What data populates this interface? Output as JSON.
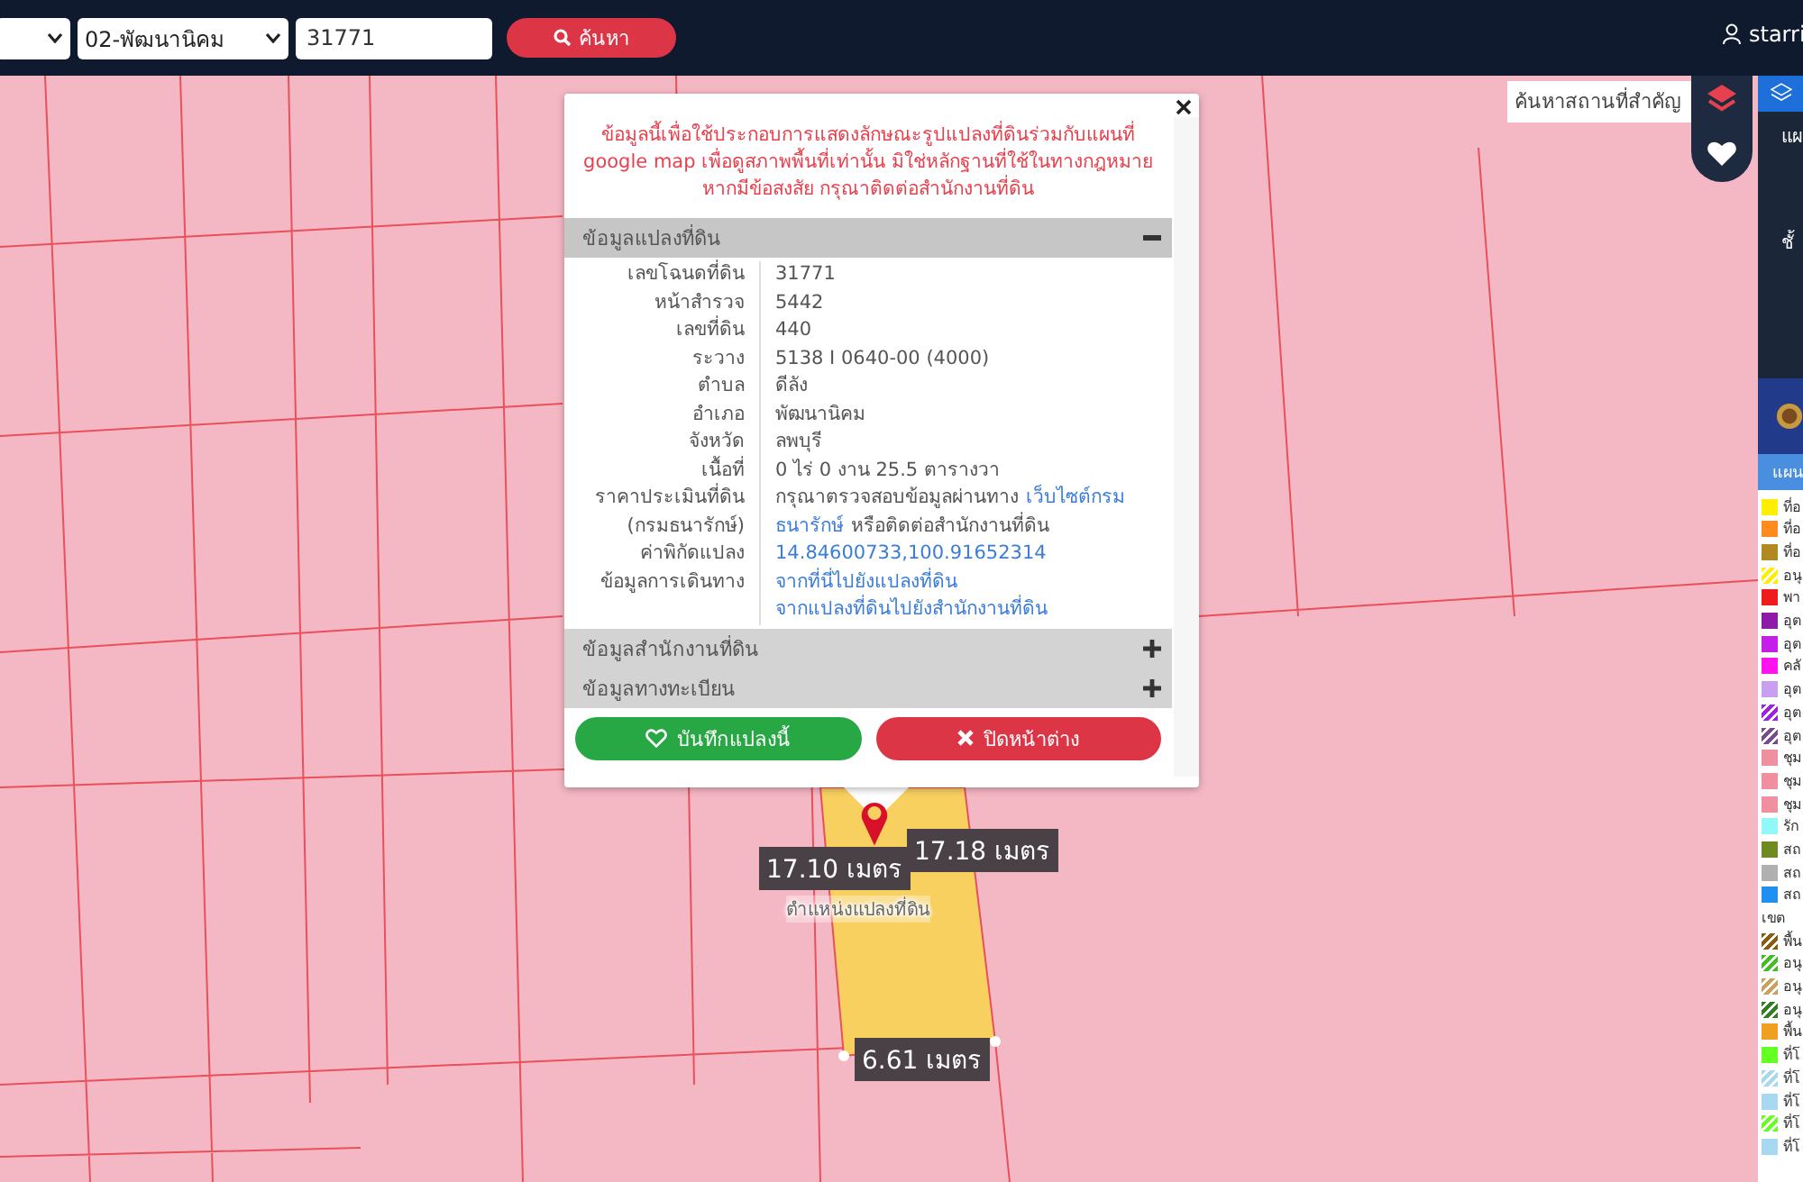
{
  "top_bar": {
    "district_select": {
      "value": "02-พัฒนานิคม"
    },
    "deed_field": {
      "value": "31771"
    },
    "search_button": {
      "label": "ค้นหา"
    },
    "user": {
      "name": "starri"
    }
  },
  "map": {
    "search_field": {
      "placeholder": "ค้นหาสถานที่สำคัญ"
    },
    "measurements": [
      {
        "label": "17.10 เมตร",
        "kind": "left"
      },
      {
        "label": "17.18 เมตร",
        "kind": "right"
      },
      {
        "label": "6.61 เมตร",
        "kind": "bottom"
      }
    ],
    "marker_label": "ตำแหน่งแปลงที่ดิน"
  },
  "popup": {
    "notice": "ข้อมูลนี้เพื่อใช้ประกอบการแสดงลักษณะรูปแปลงที่ดินร่วมกับแผนที่ google map เพื่อดูสภาพพื้นที่เท่านั้น มิใช่หลักฐานที่ใช้ในทางกฎหมาย หากมีข้อสงสัย กรุณาติดต่อสำนักงานที่ดิน",
    "sections": [
      {
        "title": "ข้อมูลแปลงที่ดิน",
        "expanded": true,
        "rows": [
          {
            "label": "เลขโฉนดที่ดิน",
            "value": [
              {
                "text": "31771",
                "link": false
              }
            ]
          },
          {
            "label": "หน้าสำรวจ",
            "value": [
              {
                "text": "5442",
                "link": false
              }
            ]
          },
          {
            "label": "เลขที่ดิน",
            "value": [
              {
                "text": "440",
                "link": false
              }
            ]
          },
          {
            "label": "ระวาง",
            "value": [
              {
                "text": "5138 I 0640-00 (4000)",
                "link": false
              }
            ]
          },
          {
            "label": "ตำบล",
            "value": [
              {
                "text": "ดีลัง",
                "link": false
              }
            ]
          },
          {
            "label": "อำเภอ",
            "value": [
              {
                "text": "พัฒนานิคม",
                "link": false
              }
            ]
          },
          {
            "label": "จังหวัด",
            "value": [
              {
                "text": "ลพบุรี",
                "link": false
              }
            ]
          },
          {
            "label": "เนื้อที่",
            "value": [
              {
                "text": "0 ไร่ 0 งาน 25.5 ตารางวา",
                "link": false
              }
            ]
          },
          {
            "label": "ราคาประเมินที่ดิน",
            "value": [
              {
                "text": "กรุณาตรวจสอบข้อมูลผ่านทาง",
                "link": false
              },
              {
                "text": "เว็บไซต์กรม",
                "link": true
              }
            ]
          },
          {
            "label": "(กรมธนารักษ์)",
            "value": [
              {
                "text": "ธนารักษ์",
                "link": true
              },
              {
                "text": "หรือติดต่อสำนักงานที่ดิน",
                "link": false
              }
            ]
          },
          {
            "label": "ค่าพิกัดแปลง",
            "value": [
              {
                "text": "14.84600733,100.91652314",
                "link": true
              }
            ]
          },
          {
            "label": "ข้อมูลการเดินทาง",
            "value": [
              {
                "text": "จากที่นี่ไปยังแปลงที่ดิน",
                "link": true
              }
            ]
          },
          {
            "value": [
              {
                "text": "จากแปลงที่ดินไปยังสำนักงานที่ดิน",
                "link": true
              }
            ]
          }
        ]
      },
      {
        "title": "ข้อมูลสำนักงานที่ดิน",
        "expanded": false
      },
      {
        "title": "ข้อมูลทางทะเบียน",
        "expanded": false
      }
    ],
    "buttons": [
      {
        "label": "บันทึกแปลงนี้",
        "kind": "save"
      },
      {
        "label": "ปิดหน้าต่าง",
        "kind": "close"
      }
    ]
  },
  "side_panel": {
    "title": "แผ",
    "layer_label": "ชั้",
    "band_label": "แผน",
    "legend": [
      {
        "label": "ที่อ",
        "color": "#ffee00",
        "kind": "solid"
      },
      {
        "label": "ที่อ",
        "color": "#ff8a1e",
        "kind": "solid"
      },
      {
        "label": "ที่อ",
        "color": "#b08a20",
        "kind": "solid"
      },
      {
        "label": "อนุ",
        "color": "#ffee00",
        "kind": "hatched"
      },
      {
        "label": "พา",
        "color": "#ee1c1c",
        "kind": "solid"
      },
      {
        "label": "อุต",
        "color": "#8e1aa8",
        "kind": "solid"
      },
      {
        "label": "อุต",
        "color": "#c41ee8",
        "kind": "solid"
      },
      {
        "label": "คลั",
        "color": "#ff14f0",
        "kind": "solid"
      },
      {
        "label": "อุต",
        "color": "#c8a0f0",
        "kind": "solid"
      },
      {
        "label": "อุต",
        "color": "#a020e0",
        "kind": "hatched"
      },
      {
        "label": "อุต",
        "color": "#7a4a90",
        "kind": "hatched"
      },
      {
        "label": "ชุม",
        "color": "#f08fa0",
        "kind": "solid"
      },
      {
        "label": "ชุม",
        "color": "#f08fa0",
        "kind": "solid"
      },
      {
        "label": "ชุม",
        "color": "#f08fa0",
        "kind": "solid"
      },
      {
        "label": "รัก",
        "color": "#90f8f8",
        "kind": "solid"
      },
      {
        "label": "สถ",
        "color": "#6e8a20",
        "kind": "solid"
      },
      {
        "label": "สถ",
        "color": "#b0b0b0",
        "kind": "solid"
      },
      {
        "label": "สถ",
        "color": "#2090f0",
        "kind": "solid"
      },
      {
        "label": "เขต",
        "kind": "none"
      },
      {
        "label": "พื้น",
        "color": "#8a5a10",
        "kind": "hatched"
      },
      {
        "label": "อนุ",
        "color": "#40c020",
        "kind": "hatched"
      },
      {
        "label": "อนุ",
        "color": "#c8a060",
        "kind": "hatched"
      },
      {
        "label": "อนุ",
        "color": "#308020",
        "kind": "hatched"
      },
      {
        "label": "พื้น",
        "color": "#f0a020",
        "kind": "solid"
      },
      {
        "label": "ที่โ",
        "color": "#66ff22",
        "kind": "solid"
      },
      {
        "label": "ที่โ",
        "color": "#a8d8f0",
        "kind": "hatched"
      },
      {
        "label": "ที่โ",
        "color": "#a8d8f0",
        "kind": "solid"
      },
      {
        "label": "ที่โ",
        "color": "#66ff22",
        "kind": "hatched"
      },
      {
        "label": "ที่โ",
        "color": "#a8d8f0",
        "kind": "solid"
      }
    ]
  }
}
